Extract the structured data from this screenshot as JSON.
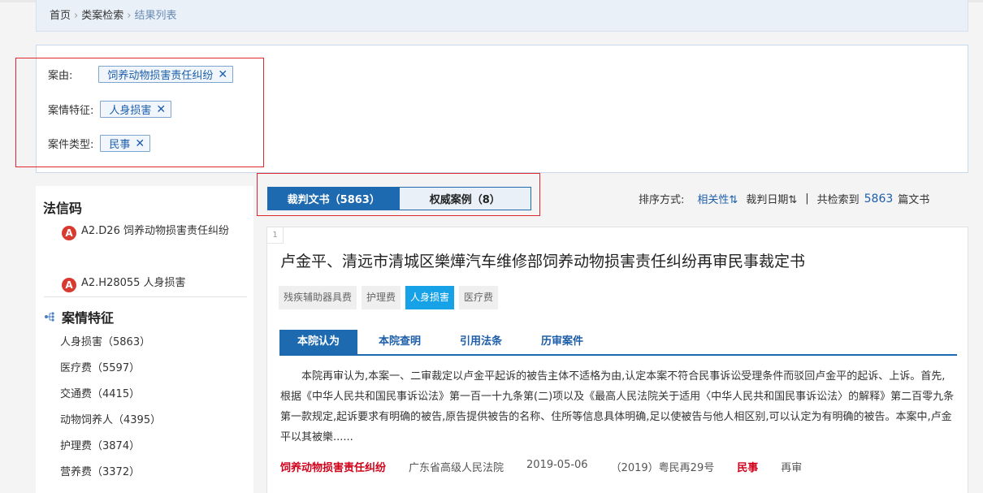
{
  "breadcrumb": {
    "home": "首页",
    "search": "类案检索",
    "current": "结果列表",
    "sep": "›"
  },
  "filters": [
    {
      "label": "案由:",
      "value": "饲养动物损害责任纠纷"
    },
    {
      "label": "案情特征:",
      "value": "人身损害"
    },
    {
      "label": "案件类型:",
      "value": "民事"
    }
  ],
  "close_glyph": "✕",
  "sidebar": {
    "title": "法信码",
    "codes": [
      {
        "icon": "A",
        "text": "A2.D26 饲养动物损害责任纠纷"
      },
      {
        "icon": "A",
        "text": "A2.H28055 人身损害"
      }
    ],
    "section_title": "案情特征",
    "features": [
      "人身损害（5863）",
      "医疗费（5597）",
      "交通费（4415）",
      "动物饲养人（4395）",
      "护理费（3874）",
      "营养费（3372）"
    ]
  },
  "doc_tabs": [
    {
      "label": "裁判文书（5863）",
      "active": true
    },
    {
      "label": "权威案例（8）",
      "active": false
    }
  ],
  "sort": {
    "label": "排序方式:",
    "option1": "相关性",
    "option2": "裁判日期",
    "arrow": "⇅",
    "pipe": "|",
    "total_prefix": "共检索到",
    "total": "5863",
    "total_suffix": "篇文书"
  },
  "result": {
    "index": "1",
    "title": "卢金平、清远市清城区樂燁汽车维修部饲养动物损害责任纠纷再审民事裁定书",
    "tags": [
      {
        "label": "残疾辅助器具费",
        "on": false
      },
      {
        "label": "护理费",
        "on": false
      },
      {
        "label": "人身损害",
        "on": true
      },
      {
        "label": "医疗费",
        "on": false
      }
    ],
    "subtabs": [
      "本院认为",
      "本院查明",
      "引用法条",
      "历审案件"
    ],
    "excerpt": "本院再审认为,本案一、二审裁定以卢金平起诉的被告主体不适格为由,认定本案不符合民事诉讼受理条件而驳回卢金平的起诉、上诉。首先,根据《中华人民共和国民事诉讼法》第一百一十九条第(二)项以及《最高人民法院关于适用〈中华人民共和国民事诉讼法〉的解释》第二百零九条第一款规定,起诉要求有明确的被告,原告提供被告的名称、住所等信息具体明确,足以使被告与他人相区别,可以认定为有明确的被告。本案中,卢金平以其被樂......",
    "meta": {
      "cause": "饲养动物损害责任纠纷",
      "court": "广东省高级人民法院",
      "date": "2019-05-06",
      "case_no": "（2019）粤民再29号",
      "case_type": "民事",
      "procedure": "再审"
    }
  },
  "colors": {
    "primary": "#1e6ab1",
    "highlight_border": "#e0262f",
    "tag_on": "#17a2e8",
    "accent_red": "#d0021b"
  }
}
